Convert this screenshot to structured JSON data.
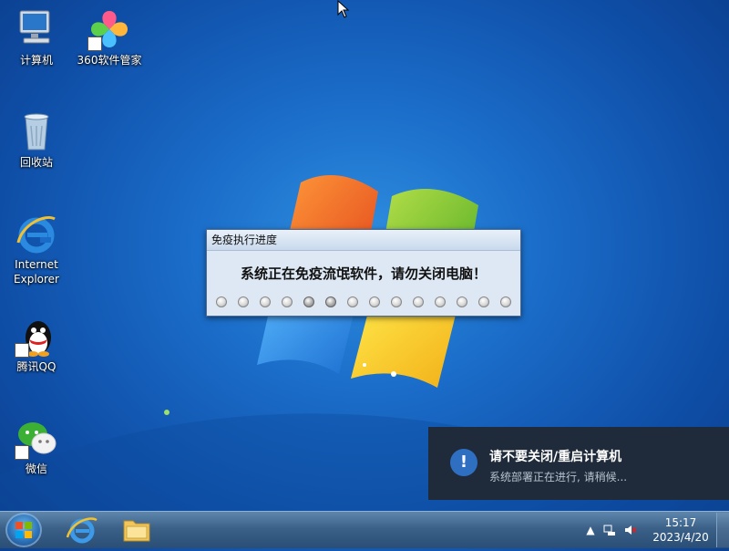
{
  "desktop": {
    "icons": [
      {
        "label": "计算机",
        "icon": "computer-icon"
      },
      {
        "label": "360软件管家",
        "icon": "360-software-manager-icon"
      },
      {
        "label": "回收站",
        "icon": "recycle-bin-icon"
      },
      {
        "label": "Internet Explorer",
        "icon": "internet-explorer-icon"
      },
      {
        "label": "腾讯QQ",
        "icon": "qq-icon"
      },
      {
        "label": "微信",
        "icon": "wechat-icon"
      }
    ]
  },
  "dialog": {
    "title": "免疫执行进度",
    "message": "系统正在免疫流氓软件，请勿关闭电脑！"
  },
  "toast": {
    "title": "请不要关闭/重启计算机",
    "body": "系统部署正在进行, 请稍候..."
  },
  "taskbar": {
    "clock_time": "15:17",
    "clock_date": "2023/4/20"
  },
  "colors": {
    "desktop_blue": "#1a6cc8",
    "toast_bg": "#1f2b3a",
    "info_blue": "#2e6fc2"
  }
}
